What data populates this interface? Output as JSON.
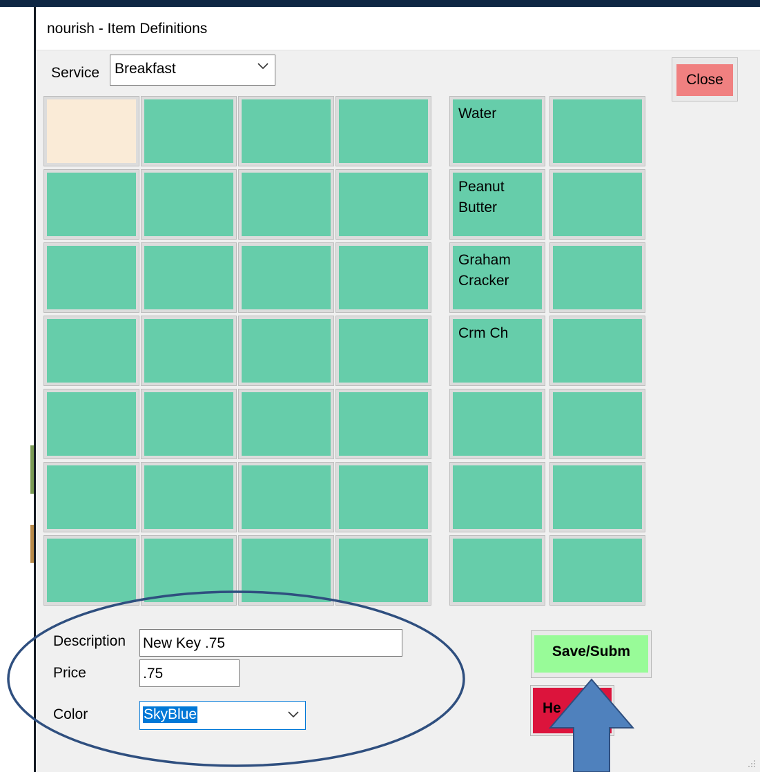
{
  "window": {
    "title": "nourish - Item Definitions"
  },
  "service": {
    "label": "Service",
    "value": "Breakfast"
  },
  "close_label": "Close",
  "grid_main": [
    [
      {
        "label": "",
        "color": "#FAEBD7"
      },
      {
        "label": "",
        "color": "#66CDAA"
      },
      {
        "label": "",
        "color": "#66CDAA"
      },
      {
        "label": "",
        "color": "#66CDAA"
      }
    ],
    [
      {
        "label": "",
        "color": "#66CDAA"
      },
      {
        "label": "",
        "color": "#66CDAA"
      },
      {
        "label": "",
        "color": "#66CDAA"
      },
      {
        "label": "",
        "color": "#66CDAA"
      }
    ],
    [
      {
        "label": "",
        "color": "#66CDAA"
      },
      {
        "label": "",
        "color": "#66CDAA"
      },
      {
        "label": "",
        "color": "#66CDAA"
      },
      {
        "label": "",
        "color": "#66CDAA"
      }
    ],
    [
      {
        "label": "",
        "color": "#66CDAA"
      },
      {
        "label": "",
        "color": "#66CDAA"
      },
      {
        "label": "",
        "color": "#66CDAA"
      },
      {
        "label": "",
        "color": "#66CDAA"
      }
    ],
    [
      {
        "label": "",
        "color": "#66CDAA"
      },
      {
        "label": "",
        "color": "#66CDAA"
      },
      {
        "label": "",
        "color": "#66CDAA"
      },
      {
        "label": "",
        "color": "#66CDAA"
      }
    ],
    [
      {
        "label": "",
        "color": "#66CDAA"
      },
      {
        "label": "",
        "color": "#66CDAA"
      },
      {
        "label": "",
        "color": "#66CDAA"
      },
      {
        "label": "",
        "color": "#66CDAA"
      }
    ],
    [
      {
        "label": "",
        "color": "#66CDAA"
      },
      {
        "label": "",
        "color": "#66CDAA"
      },
      {
        "label": "",
        "color": "#66CDAA"
      },
      {
        "label": "",
        "color": "#66CDAA"
      }
    ]
  ],
  "grid_side": [
    [
      {
        "label": "Water",
        "color": "#66CDAA"
      },
      {
        "label": "",
        "color": "#66CDAA"
      }
    ],
    [
      {
        "label": "Peanut Butter",
        "color": "#66CDAA"
      },
      {
        "label": "",
        "color": "#66CDAA"
      }
    ],
    [
      {
        "label": "Graham Cracker",
        "color": "#66CDAA"
      },
      {
        "label": "",
        "color": "#66CDAA"
      }
    ],
    [
      {
        "label": "Crm Ch",
        "color": "#66CDAA"
      },
      {
        "label": "",
        "color": "#66CDAA"
      }
    ],
    [
      {
        "label": "",
        "color": "#66CDAA"
      },
      {
        "label": "",
        "color": "#66CDAA"
      }
    ],
    [
      {
        "label": "",
        "color": "#66CDAA"
      },
      {
        "label": "",
        "color": "#66CDAA"
      }
    ],
    [
      {
        "label": "",
        "color": "#66CDAA"
      },
      {
        "label": "",
        "color": "#66CDAA"
      }
    ]
  ],
  "form": {
    "description_label": "Description",
    "description_value": "New Key .75",
    "price_label": "Price",
    "price_value": ".75",
    "color_label": "Color",
    "color_value": "SkyBlue"
  },
  "save_label": "Save/Subm",
  "help_label": "He",
  "colors": {
    "accent_close": "#F08080",
    "accent_save": "#98FB98",
    "accent_help": "#DC143C",
    "annotation": "#4F81BD",
    "annotation_outline": "#2F4F7F"
  }
}
